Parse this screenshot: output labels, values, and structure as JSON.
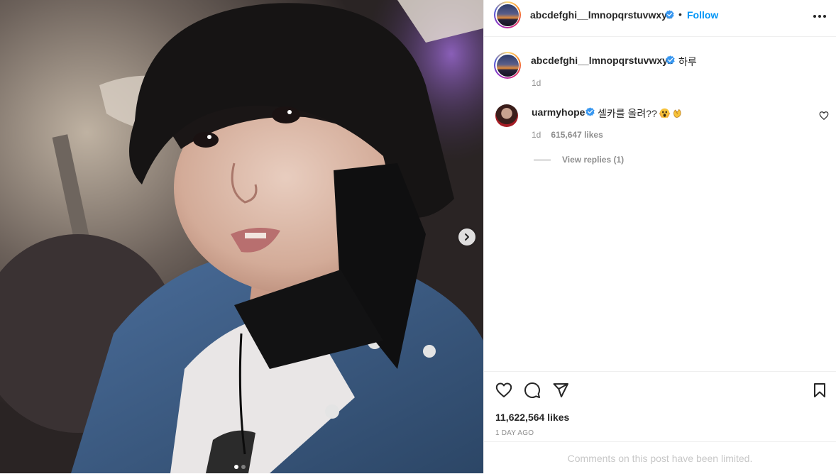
{
  "post": {
    "media": {
      "photo_icon": "selfie-photo",
      "next_icon": "chevron-right-icon",
      "carousel_total": 2,
      "carousel_active": 1
    },
    "header": {
      "username": "abcdefghi__lmnopqrstuvwxyz",
      "bullet": "•",
      "follow_label": "Follow",
      "more_icon": "more-horizontal-icon"
    },
    "caption": {
      "username": "abcdefghi__lmnopqrstuvwxyz",
      "text": "하루",
      "time": "1d"
    },
    "comment": {
      "username": "uarmyhope",
      "text": "셀카를 올려??",
      "emojis": [
        "screaming-face-emoji",
        "clapping-hands-emoji"
      ],
      "time": "1d",
      "likes": "615,647 likes",
      "view_replies": "View replies (1)"
    },
    "actions": {
      "icons": [
        "heart-icon",
        "comment-icon",
        "share-icon",
        "bookmark-icon"
      ],
      "likes": "11,622,564 likes",
      "date": "1 DAY AGO",
      "limited_notice": "Comments on this post have been limited."
    },
    "colors": {
      "accent": "#0095f6",
      "verified": "#3897f0",
      "secondary_text": "#8e8e8e",
      "divider": "#efefef"
    }
  }
}
